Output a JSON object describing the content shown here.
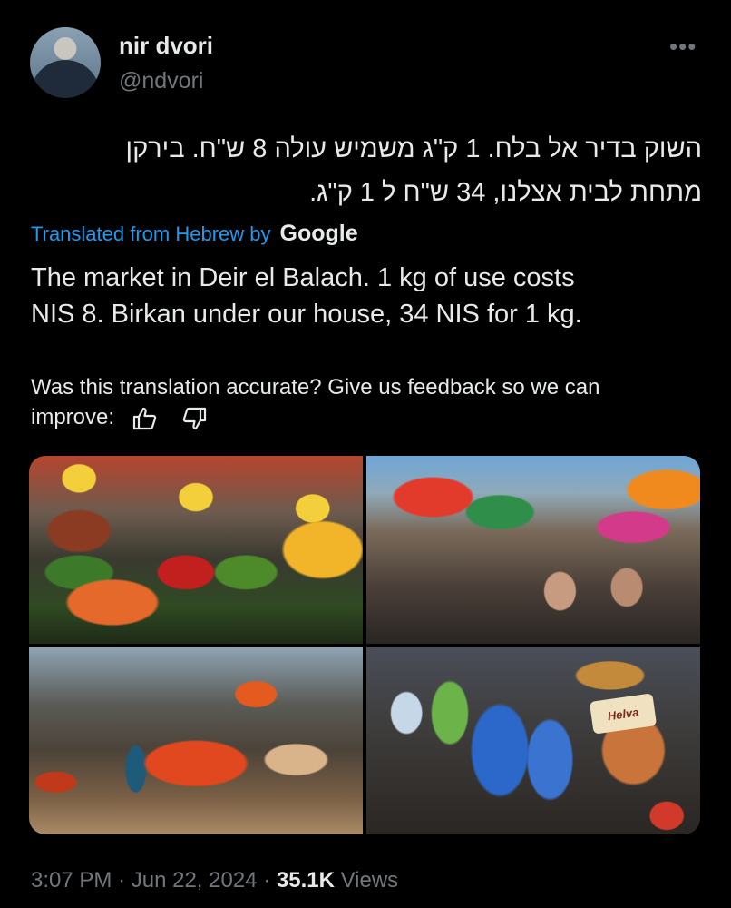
{
  "author": {
    "name": "nir dvori",
    "handle": "@ndvori"
  },
  "tweet": {
    "hebrew_line1": "השוק בדיר אל בלח. 1 ק\"ג משמיש עולה 8 ש\"ח.  בירקן",
    "hebrew_line2": "מתחת לבית אצלנו, 34 ש\"ח ל 1 ק\"ג.",
    "translated_label": "Translated from Hebrew by",
    "translator": "Google",
    "translation_line1": "The market in Deir el Balach. 1 kg of use costs",
    "translation_line2": "NIS 8. Birkan under our house, 34 NIS for 1 kg.",
    "feedback_line1": "Was this translation accurate? Give us feedback so we can",
    "feedback_line2": "improve:"
  },
  "media": {
    "helva_label": "Helva"
  },
  "meta": {
    "time": "3:07 PM",
    "date": "Jun 22, 2024",
    "views_count": "35.1K",
    "views_label": "Views"
  }
}
